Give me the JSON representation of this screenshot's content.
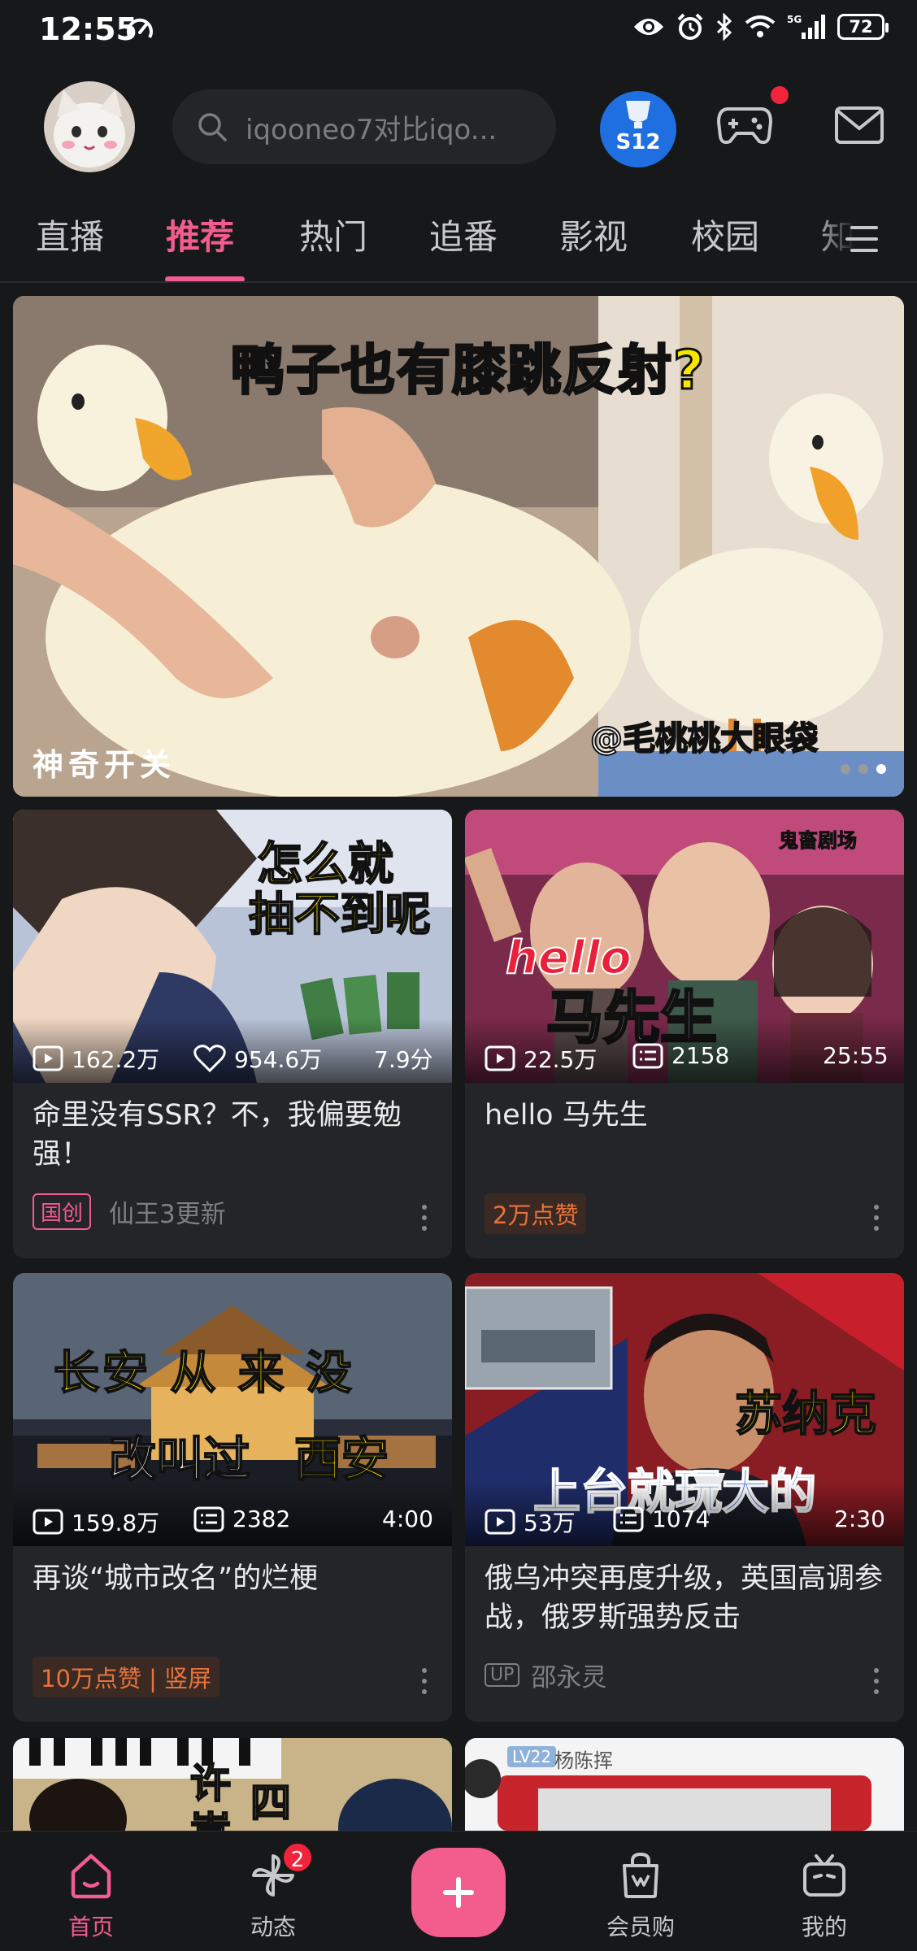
{
  "status_bar": {
    "time": "12:55",
    "battery": "72",
    "network": "5G",
    "icons": [
      "speed-icon",
      "eye-icon",
      "alarm-icon",
      "bluetooth-icon",
      "wifi-icon",
      "signal-icon",
      "battery-icon"
    ]
  },
  "header": {
    "search_placeholder": "iqooneo7对比iqo...",
    "s12_label": "S12",
    "colors": {
      "accent": "#f25d8e",
      "background": "#17181a",
      "card": "#242528"
    }
  },
  "tabs": [
    {
      "label": "直播"
    },
    {
      "label": "推荐",
      "active": true
    },
    {
      "label": "热门"
    },
    {
      "label": "追番"
    },
    {
      "label": "影视"
    },
    {
      "label": "校园"
    },
    {
      "label": "知"
    }
  ],
  "banner": {
    "title_part1": "鸭子也有",
    "title_highlight": "膝跳反射",
    "title_part2": "?",
    "watermark": "@毛桃桃大眼袋",
    "caption": "神奇开关",
    "active_slide_index": 2,
    "slide_count": 3
  },
  "cards": [
    {
      "overlay_line1": "怎么就",
      "overlay_line2": "抽不到呢",
      "views": "162.2万",
      "likes": "954.6万",
      "score": "7.9分",
      "title": "命里没有SSR？不，我偏要勉强！",
      "tag": "国创",
      "meta": "仙王3更新"
    },
    {
      "corner_label": "鬼畜剧场",
      "overlay_en": "hello",
      "overlay_cn": "马先生",
      "views": "22.5万",
      "danmaku": "2158",
      "duration": "25:55",
      "title": "hello 马先生",
      "tag": "2万点赞"
    },
    {
      "overlay_line1": "长安 从 来 没",
      "overlay_line2a": "改叫过",
      "overlay_line2b": "西安",
      "views": "159.8万",
      "danmaku": "2382",
      "duration": "4:00",
      "title": "再谈“城市改名”的烂梗",
      "tag": "10万点赞 | 竖屏"
    },
    {
      "overlay_line1": "苏纳克",
      "overlay_line2": "上台就玩大的",
      "views": "53万",
      "danmaku": "1074",
      "duration": "2:30",
      "title": "俄乌冲突再度升级，英国高调参战，俄罗斯强势反击",
      "up_badge": "UP",
      "meta": "邵永灵"
    }
  ],
  "partial_cards": {
    "left_overlay_a": "许",
    "left_overlay_b": "四",
    "left_overlay_c": "嵩",
    "right_level": "LV22",
    "right_name": "杨陈挥"
  },
  "bottom_nav": [
    {
      "label": "首页",
      "icon": "home-icon",
      "active": true
    },
    {
      "label": "动态",
      "icon": "pinwheel-icon",
      "badge": "2"
    },
    {
      "label": "",
      "icon": "plus-icon"
    },
    {
      "label": "会员购",
      "icon": "shopping-bag-icon"
    },
    {
      "label": "我的",
      "icon": "tv-face-icon"
    }
  ]
}
